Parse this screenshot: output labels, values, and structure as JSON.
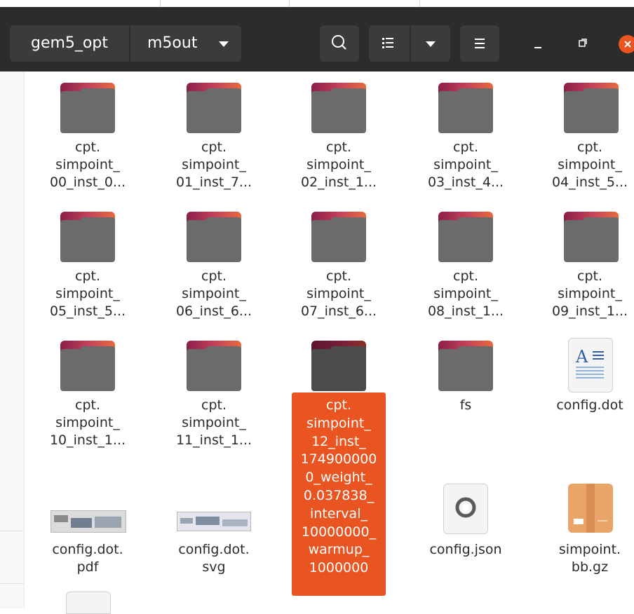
{
  "header": {
    "path": [
      "gem5_opt",
      "m5out"
    ]
  },
  "toolbar": {
    "icons": [
      "search-icon",
      "list-view-icon",
      "chevron-down-icon",
      "menu-icon"
    ]
  },
  "window": {
    "icons": [
      "minimize-icon",
      "restore-icon",
      "close-icon"
    ],
    "close_color": "#e95420"
  },
  "colors": {
    "accent": "#e95420",
    "header": "#2c2c2c"
  },
  "files": [
    {
      "lines": [
        "cpt.",
        "simpoint_",
        "00_inst_0..."
      ],
      "type": "folder"
    },
    {
      "lines": [
        "cpt.",
        "simpoint_",
        "01_inst_7..."
      ],
      "type": "folder"
    },
    {
      "lines": [
        "cpt.",
        "simpoint_",
        "02_inst_1..."
      ],
      "type": "folder"
    },
    {
      "lines": [
        "cpt.",
        "simpoint_",
        "03_inst_4..."
      ],
      "type": "folder"
    },
    {
      "lines": [
        "cpt.",
        "simpoint_",
        "04_inst_5..."
      ],
      "type": "folder"
    },
    {
      "lines": [
        "cpt.",
        "simpoint_",
        "05_inst_5..."
      ],
      "type": "folder"
    },
    {
      "lines": [
        "cpt.",
        "simpoint_",
        "06_inst_6..."
      ],
      "type": "folder"
    },
    {
      "lines": [
        "cpt.",
        "simpoint_",
        "07_inst_6..."
      ],
      "type": "folder"
    },
    {
      "lines": [
        "cpt.",
        "simpoint_",
        "08_inst_1..."
      ],
      "type": "folder"
    },
    {
      "lines": [
        "cpt.",
        "simpoint_",
        "09_inst_1..."
      ],
      "type": "folder"
    },
    {
      "lines": [
        "cpt.",
        "simpoint_",
        "10_inst_1..."
      ],
      "type": "folder"
    },
    {
      "lines": [
        "cpt.",
        "simpoint_",
        "11_inst_1..."
      ],
      "type": "folder"
    },
    {
      "lines": [
        "cpt.",
        "simpoint_",
        "12_inst_",
        "174900000",
        "0_weight_",
        "0.037838_",
        "interval_",
        "10000000_",
        "warmup_",
        "1000000"
      ],
      "type": "folder",
      "selected": true
    },
    {
      "lines": [
        "fs"
      ],
      "type": "folder"
    },
    {
      "lines": [
        "config.dot"
      ],
      "type": "text-file"
    },
    {
      "lines": [
        "config.dot.",
        "pdf"
      ],
      "type": "pdf-file"
    },
    {
      "lines": [
        "config.dot.",
        "svg"
      ],
      "type": "svg-file"
    },
    {
      "lines": [
        "config.json"
      ],
      "type": "json-file"
    },
    {
      "lines": [
        "simpoint.",
        "bb.gz"
      ],
      "type": "archive-file"
    }
  ]
}
